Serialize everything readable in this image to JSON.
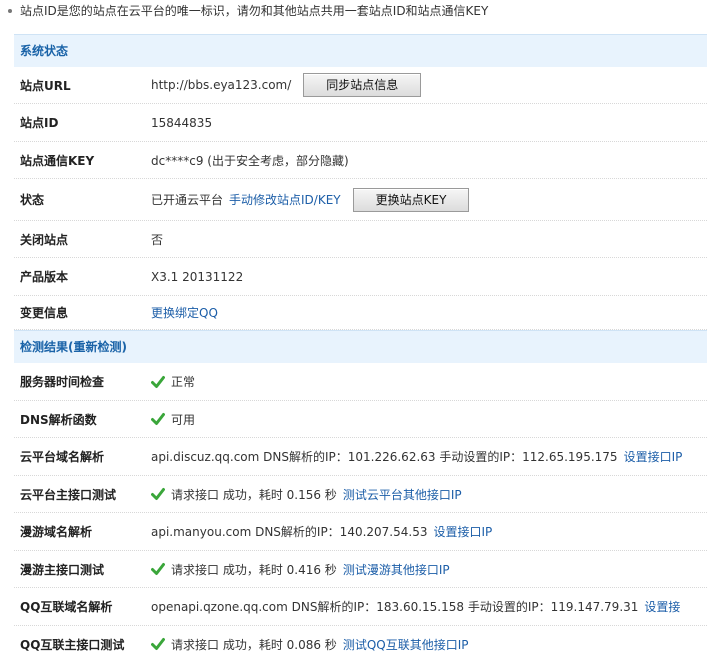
{
  "notice": "站点ID是您的站点在云平台的唯一标识，请勿和其他站点共用一套站点ID和站点通信KEY",
  "status_section": {
    "title": "系统状态",
    "site_url": {
      "label": "站点URL",
      "value": "http://bbs.eya123.com/",
      "button": "同步站点信息"
    },
    "site_id": {
      "label": "站点ID",
      "value": "15844835"
    },
    "site_key": {
      "label": "站点通信KEY",
      "value": "dc****c9 (出于安全考虑，部分隐藏)"
    },
    "state": {
      "label": "状态",
      "value": "已开通云平台",
      "link": "手动修改站点ID/KEY",
      "button": "更换站点KEY"
    },
    "closed": {
      "label": "关闭站点",
      "value": "否"
    },
    "version": {
      "label": "产品版本",
      "value": "X3.1 20131122"
    },
    "change": {
      "label": "变更信息",
      "link": "更换绑定QQ"
    }
  },
  "check_section": {
    "title": "检测结果(",
    "recheck": "重新检测",
    "title_end": ")",
    "server_time": {
      "label": "服务器时间检查",
      "value": "正常",
      "icon": "check-icon"
    },
    "dns_func": {
      "label": "DNS解析函数",
      "value": "可用",
      "icon": "check-icon"
    },
    "cloud_dns": {
      "label": "云平台域名解析",
      "value": "api.discuz.qq.com DNS解析的IP：101.226.62.63 手动设置的IP：112.65.195.175",
      "link": "设置接口IP"
    },
    "cloud_api": {
      "label": "云平台主接口测试",
      "value": "请求接口 成功，耗时 0.156 秒",
      "link": "测试云平台其他接口IP"
    },
    "manyou_dns": {
      "label": "漫游域名解析",
      "value": "api.manyou.com DNS解析的IP：140.207.54.53",
      "link": "设置接口IP"
    },
    "manyou_api": {
      "label": "漫游主接口测试",
      "value": "请求接口 成功，耗时 0.416 秒",
      "link": "测试漫游其他接口IP"
    },
    "qq_dns": {
      "label": "QQ互联域名解析",
      "value": "openapi.qzone.qq.com DNS解析的IP：183.60.15.158 手动设置的IP：119.147.79.31",
      "link": "设置接"
    },
    "qq_api": {
      "label": "QQ互联主接口测试",
      "value": "请求接口 成功，耗时 0.086 秒",
      "link": "测试QQ互联其他接口IP"
    }
  },
  "colors": {
    "accent": "#1c5ea8",
    "header_bg": "#e8f3fd",
    "check": "#3aa63a"
  }
}
